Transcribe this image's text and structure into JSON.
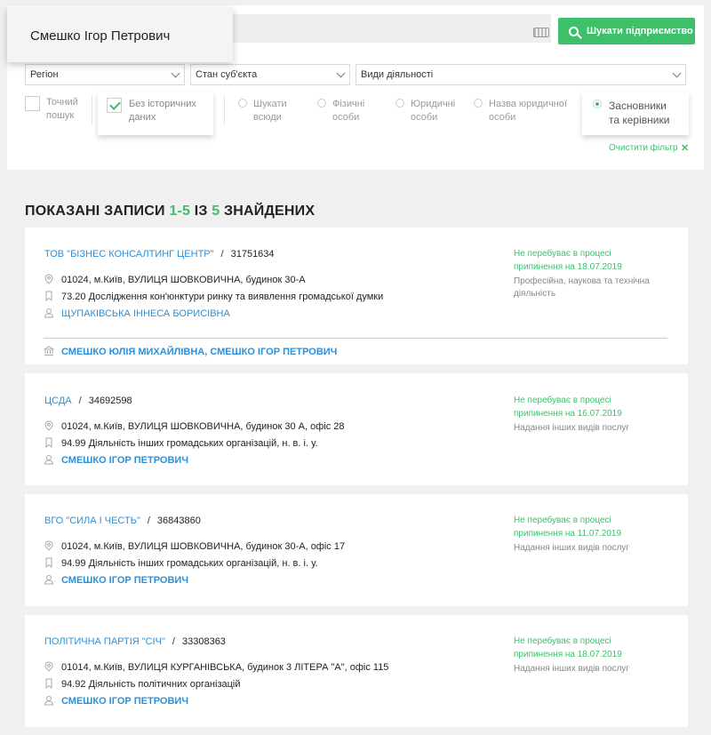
{
  "search": {
    "query": "Смешко Ігор Петрович",
    "button_label": "Шукати підприємство"
  },
  "selects": {
    "region": "Регіон",
    "status": "Стан суб'єкта",
    "activities": "Види діяльності"
  },
  "filters": {
    "exact_line1": "Точний",
    "exact_line2": "пошук",
    "no_history_line1": "Без історичних",
    "no_history_line2": "даних",
    "search_all_line1": "Шукати",
    "search_all_line2": "всюди",
    "physical_line1": "Фізичні",
    "physical_line2": "особи",
    "legal_line1": "Юридичні",
    "legal_line2": "особи",
    "company_name_line1": "Назва юридичної",
    "company_name_line2": "особи",
    "founders_line1": "Засновники",
    "founders_line2": "та керівники",
    "clear_filter": "Очистити фільтр"
  },
  "results": {
    "prefix": "ПОКАЗАНІ ЗАПИСИ ",
    "range": "1-5",
    "middle": " ІЗ ",
    "total": "5",
    "suffix": " ЗНАЙДЕНИХ"
  },
  "companies": [
    {
      "name": "ТОВ \"БІЗНЕС КОНСАЛТИНГ ЦЕНТР\"",
      "code": "31751634",
      "address": "01024, м.Київ, ВУЛИЦЯ ШОВКОВИЧНА, будинок 30-А",
      "kved": "73.20 Дослідження кон'юнктури ринку та виявлення громадської думки",
      "head": "ЩУПАКІВСЬКА ІННЕСА БОРИСІВНА",
      "status_line1": "Не перебуває в процесі",
      "status_line2": "припинення на 18.07.2019",
      "activity_line1": "Професійна, наукова та технічна",
      "activity_line2": "діяльність",
      "founder1": "СМЕШКО ЮЛІЯ МИХАЙЛІВНА",
      "founder_sep": ", ",
      "founder2": "СМЕШКО ІГОР ПЕТРОВИЧ"
    },
    {
      "name": "ЦСДА",
      "code": "34692598",
      "address": "01024, м.Київ, ВУЛИЦЯ ШОВКОВИЧНА, будинок 30 А, офіс 28",
      "kved": "94.99 Діяльність інших громадських організацій, н. в. і. у.",
      "head": "СМЕШКО ІГОР ПЕТРОВИЧ",
      "status_line1": "Не перебуває в процесі",
      "status_line2": "припинення на 16.07.2019",
      "activity_line1": "Надання інших видів послуг"
    },
    {
      "name": "ВГО \"СИЛА І ЧЕСТЬ\"",
      "code": "36843860",
      "address": "01024, м.Київ, ВУЛИЦЯ ШОВКОВИЧНА, будинок 30-А, офіс 17",
      "kved": "94.99 Діяльність інших громадських організацій, н. в. і. у.",
      "head": "СМЕШКО ІГОР ПЕТРОВИЧ",
      "status_line1": "Не перебуває в процесі",
      "status_line2": "припинення на 11.07.2019",
      "activity_line1": "Надання інших видів послуг"
    },
    {
      "name": "ПОЛІТИЧНА ПАРТІЯ \"СІЧ\"",
      "code": "33308363",
      "address": "01014, м.Київ, ВУЛИЦЯ КУРГАНІВСЬКА, будинок 3 ЛІТЕРА \"А\", офіс 115",
      "kved": "94.92 Діяльність політичних організацій",
      "head": "СМЕШКО ІГОР ПЕТРОВИЧ",
      "status_line1": "Не перебуває в процесі",
      "status_line2": "припинення на 18.07.2019",
      "activity_line1": "Надання інших видів послуг"
    }
  ],
  "name_separator": "/",
  "colors": {
    "accent_green": "#3ec06b",
    "link_blue": "#2f8fd6",
    "background": "#f0f0f0"
  },
  "icons": {
    "address": "map-pin-icon",
    "kved": "bookmark-icon",
    "person": "user-icon",
    "founders": "bank-icon",
    "search": "search-icon",
    "keyboard": "keyboard-icon"
  }
}
